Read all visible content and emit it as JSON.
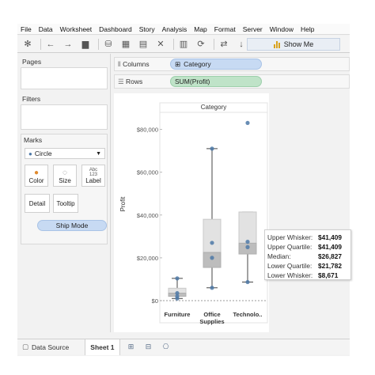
{
  "menu": [
    "File",
    "Data",
    "Worksheet",
    "Dashboard",
    "Story",
    "Analysis",
    "Map",
    "Format",
    "Server",
    "Window",
    "Help"
  ],
  "toolbar": {
    "show_me_label": "Show Me"
  },
  "left": {
    "pages_label": "Pages",
    "filters_label": "Filters",
    "marks_label": "Marks",
    "mark_type": "Circle",
    "color_label": "Color",
    "size_label": "Size",
    "label_label": "Label",
    "label_icon_text": "Abc 123",
    "detail_label": "Detail",
    "tooltip_label": "Tooltip",
    "ship_mode_pill": "Ship Mode"
  },
  "shelves": {
    "columns_label": "Columns",
    "columns_pill": "Category",
    "rows_label": "Rows",
    "rows_pill": "SUM(Profit)"
  },
  "tooltip": {
    "rows": [
      {
        "key": "Upper Whisker:",
        "value": "$41,409"
      },
      {
        "key": "Upper Quartile:",
        "value": "$41,409"
      },
      {
        "key": "Median:",
        "value": "$26,827"
      },
      {
        "key": "Lower Quartile:",
        "value": "$21,782"
      },
      {
        "key": "Lower Whisker:",
        "value": "$8,671"
      }
    ]
  },
  "tabs": {
    "data_source": "Data Source",
    "sheet1": "Sheet 1"
  },
  "colors": {
    "accent_blue": "#4e79a7",
    "box_dark": "#bdbdbd",
    "box_light": "#e2e2e2"
  },
  "chart_data": {
    "type": "boxplot",
    "title": "Category",
    "ylabel": "Profit",
    "ylim": [
      0,
      85000
    ],
    "yticks": [
      0,
      20000,
      40000,
      60000,
      80000
    ],
    "ytick_labels": [
      "$0",
      "$20,000",
      "$40,000",
      "$60,000",
      "$80,000"
    ],
    "categories": [
      "Furniture",
      "Office Supplies",
      "Technolo.."
    ],
    "category_lines": [
      [
        "Furniture"
      ],
      [
        "Office",
        "Supplies"
      ],
      [
        "Technolo.."
      ]
    ],
    "boxes": [
      {
        "lower_whisker": 1000,
        "q1": 2000,
        "median": 3500,
        "q3": 5800,
        "upper_whisker": 10400
      },
      {
        "lower_whisker": 6000,
        "q1": 15500,
        "median": 22500,
        "q3": 38000,
        "upper_whisker": 71000
      },
      {
        "lower_whisker": 8671,
        "q1": 21782,
        "median": 26827,
        "q3": 41409,
        "upper_whisker": 41409
      }
    ],
    "points": [
      {
        "category": 0,
        "y": 1000
      },
      {
        "category": 0,
        "y": 2000
      },
      {
        "category": 0,
        "y": 3500
      },
      {
        "category": 0,
        "y": 10400
      },
      {
        "category": 1,
        "y": 6000
      },
      {
        "category": 1,
        "y": 20000
      },
      {
        "category": 1,
        "y": 27000
      },
      {
        "category": 1,
        "y": 71000
      },
      {
        "category": 2,
        "y": 8671
      },
      {
        "category": 2,
        "y": 25000
      },
      {
        "category": 2,
        "y": 27500
      },
      {
        "category": 2,
        "y": 83000
      }
    ],
    "grid": false
  }
}
